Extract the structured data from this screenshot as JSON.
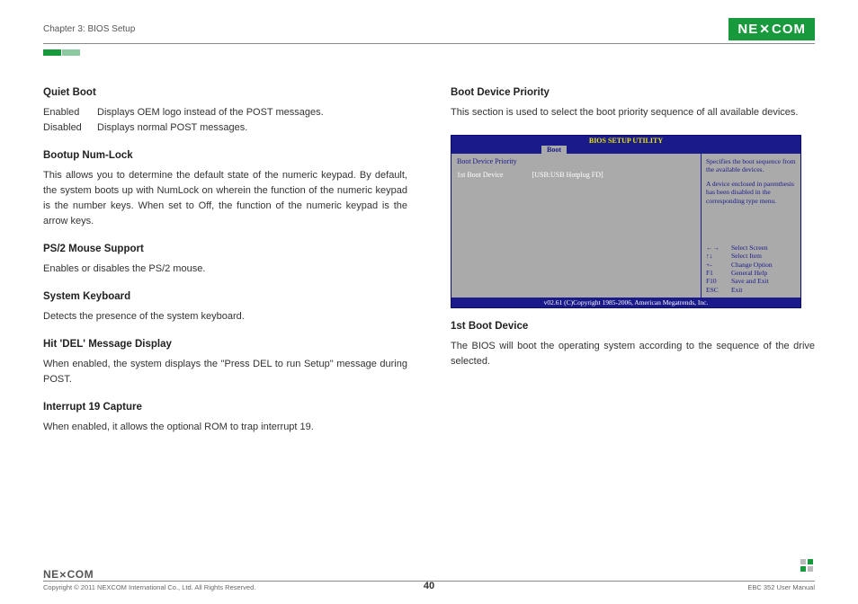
{
  "header": {
    "chapter": "Chapter 3: BIOS Setup",
    "logo_text": "NE COM"
  },
  "left": {
    "quiet_boot": {
      "title": "Quiet Boot",
      "rows": [
        {
          "k": "Enabled",
          "v": "Displays OEM logo instead of the POST messages."
        },
        {
          "k": "Disabled",
          "v": "Displays normal POST messages."
        }
      ]
    },
    "numlock": {
      "title": "Bootup Num-Lock",
      "text": "This allows you to determine the default state of the numeric keypad. By default, the system boots up with NumLock on wherein the function of the numeric keypad is the number keys. When set to Off, the function of the numeric keypad is the arrow keys."
    },
    "ps2": {
      "title": "PS/2 Mouse Support",
      "text": "Enables or disables the PS/2 mouse."
    },
    "syskb": {
      "title": "System Keyboard",
      "text": "Detects the presence of the system keyboard."
    },
    "hitdel": {
      "title": "Hit 'DEL' Message Display",
      "text": "When enabled, the system displays the \"Press DEL to run Setup\" message during POST."
    },
    "int19": {
      "title": "Interrupt 19 Capture",
      "text": "When enabled, it allows the optional ROM to trap interrupt 19."
    }
  },
  "right": {
    "priority": {
      "title": "Boot Device Priority",
      "text": "This section is used to select the boot priority sequence of all available devices."
    },
    "first": {
      "title": "1st Boot Device",
      "text": "The BIOS will boot the operating system according to the sequence of the drive selected."
    }
  },
  "bios": {
    "title": "BIOS SETUP UTILITY",
    "tab": "Boot",
    "row1": "Boot Device Priority",
    "row2_label": "1st Boot Device",
    "row2_value": "[USB:USB Hotplug FD]",
    "help1": "Specifies the boot sequence from the available devices.",
    "help2": "A device enclosed in parenthesis has been disabled in the corresponding type menu.",
    "keys": [
      {
        "k": "←→",
        "v": "Select Screen"
      },
      {
        "k": "↑↓",
        "v": "Select Item"
      },
      {
        "k": "+-",
        "v": "Change Option"
      },
      {
        "k": "F1",
        "v": "General Help"
      },
      {
        "k": "F10",
        "v": "Save and Exit"
      },
      {
        "k": "ESC",
        "v": "Exit"
      }
    ],
    "footer": "v02.61 (C)Copyright 1985-2006, American Megatrends, Inc."
  },
  "footer": {
    "logo": "NE COM",
    "copyright": "Copyright © 2011 NEXCOM International Co., Ltd. All Rights Reserved.",
    "page": "40",
    "manual": "EBC 352 User Manual"
  }
}
